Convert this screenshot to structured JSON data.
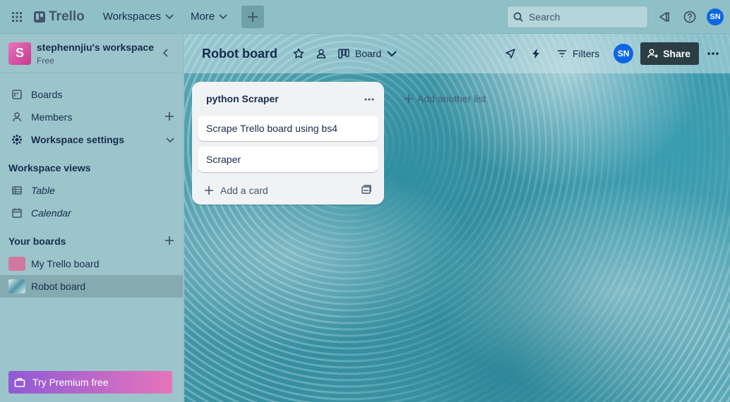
{
  "topnav": {
    "logo": "Trello",
    "menu": [
      {
        "label": "Workspaces"
      },
      {
        "label": "More"
      }
    ],
    "search_placeholder": "Search",
    "avatar_initials": "SN"
  },
  "sidebar": {
    "workspace_initial": "S",
    "workspace_name": "stephennjiu's workspace",
    "workspace_plan": "Free",
    "items": [
      {
        "label": "Boards"
      },
      {
        "label": "Members"
      },
      {
        "label": "Workspace settings"
      }
    ],
    "views_title": "Workspace views",
    "views": [
      {
        "label": "Table"
      },
      {
        "label": "Calendar"
      }
    ],
    "boards_title": "Your boards",
    "boards": [
      {
        "label": "My Trello board",
        "color": "#d0789f"
      },
      {
        "label": "Robot board"
      }
    ],
    "premium_label": "Try Premium free"
  },
  "board": {
    "title": "Robot board",
    "view_label": "Board",
    "filters_label": "Filters",
    "avatar_initials": "SN",
    "share_label": "Share",
    "add_list_label": "Add another list",
    "lists": [
      {
        "title": "python Scraper",
        "cards": [
          "Scrape Trello board using bs4",
          "Scraper"
        ],
        "add_card_label": "Add a card"
      }
    ]
  },
  "colors": {
    "accent": "#0c66e4",
    "share_bg": "#2c3e44",
    "premium_start": "#8f5ad6",
    "premium_end": "#e774bb"
  }
}
